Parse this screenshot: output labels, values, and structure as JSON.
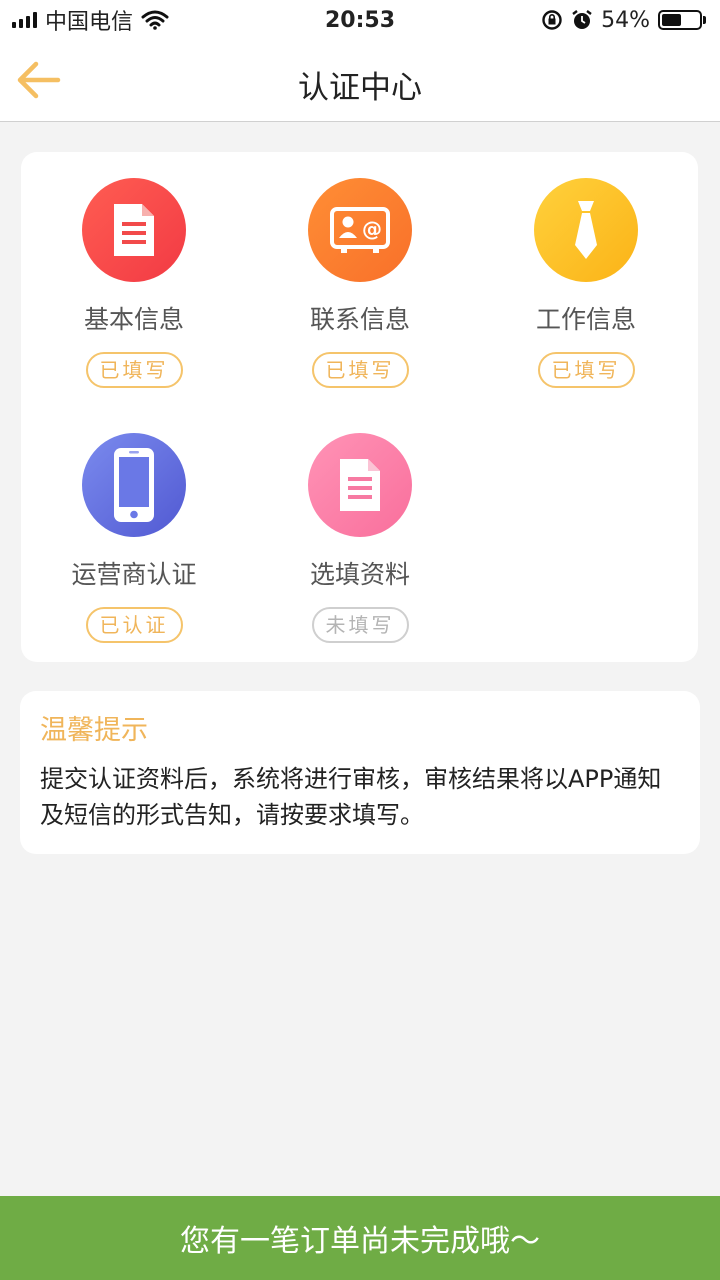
{
  "status_bar": {
    "carrier": "中国电信",
    "time": "20:53",
    "battery_percent": "54%",
    "battery_level": 0.54
  },
  "nav": {
    "title": "认证中心",
    "back_icon": "arrow-left-icon"
  },
  "colors": {
    "accent": "#f0b55a",
    "banner": "#6fac45",
    "basic": "#f54848",
    "contact": "#fb7f2f",
    "work": "#fdc223",
    "operator": "#6372de",
    "optional": "#fb7fa8"
  },
  "cert_items": [
    {
      "label": "基本信息",
      "status": "已填写",
      "icon": "document-icon",
      "done": true
    },
    {
      "label": "联系信息",
      "status": "已填写",
      "icon": "contact-card-icon",
      "done": true
    },
    {
      "label": "工作信息",
      "status": "已填写",
      "icon": "tie-icon",
      "done": true
    },
    {
      "label": "运营商认证",
      "status": "已认证",
      "icon": "phone-icon",
      "done": true
    },
    {
      "label": "选填资料",
      "status": "未填写",
      "icon": "document-icon",
      "done": false
    }
  ],
  "tips": {
    "title": "温馨提示",
    "text": "提交认证资料后，系统将进行审核，审核结果将以APP通知及短信的形式告知，请按要求填写。"
  },
  "banner": {
    "text": "您有一笔订单尚未完成哦～"
  }
}
